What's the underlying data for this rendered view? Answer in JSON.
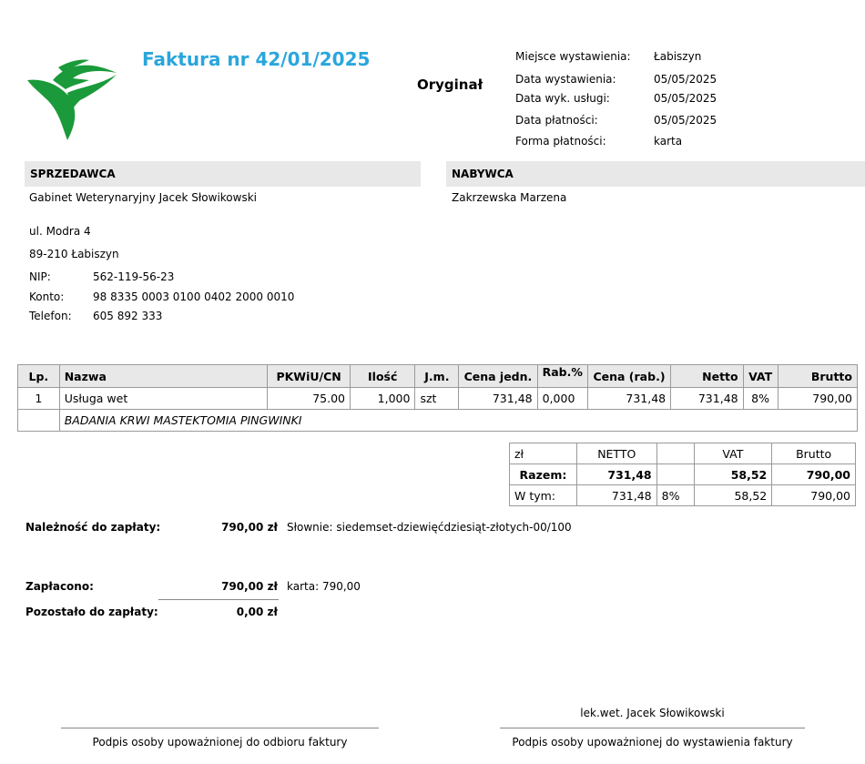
{
  "invoice": {
    "title": "Faktura nr 42/01/2025",
    "copy_label": "Oryginał"
  },
  "meta": [
    {
      "label": "Miejsce wystawienia:",
      "value": "Łabiszyn"
    },
    {
      "label": "Data wystawienia:",
      "value": "05/05/2025"
    },
    {
      "label": "Data wyk. usługi:",
      "value": "05/05/2025"
    },
    {
      "label": "Data płatności:",
      "value": "05/05/2025"
    },
    {
      "label": "Forma płatności:",
      "value": "karta"
    }
  ],
  "seller": {
    "header": "SPRZEDAWCA",
    "name": "Gabinet Weterynaryjny Jacek Słowikowski",
    "street": "ul. Modra 4",
    "city": "89-210 Łabiszyn",
    "nip_label": "NIP:",
    "nip": "562-119-56-23",
    "account_label": "Konto:",
    "account": "98 8335 0003 0100 0402 2000 0010",
    "phone_label": "Telefon:",
    "phone": "605 892 333"
  },
  "buyer": {
    "header": "NABYWCA",
    "name": "Zakrzewska Marzena"
  },
  "items_table": {
    "headers": [
      "Lp.",
      "Nazwa",
      "PKWiU/CN",
      "Ilość",
      "J.m.",
      "Cena jedn.",
      "Rab.%",
      "Cena (rab.)",
      "Netto",
      "VAT",
      "Brutto"
    ],
    "rows": [
      {
        "lp": "1",
        "name": "Usługa wet",
        "pkwiu": "75.00",
        "qty": "1,000",
        "unit": "szt",
        "price": "731,48",
        "discount": "0,000",
        "price_disc": "731,48",
        "net": "731,48",
        "vat": "8%",
        "gross": "790,00",
        "description": "BADANIA KRWI MASTEKTOMIA PINGWINKI"
      }
    ]
  },
  "summary": {
    "headers": [
      "zł",
      "NETTO",
      "",
      "VAT",
      "Brutto"
    ],
    "total": {
      "label": "Razem:",
      "net": "731,48",
      "vat": "58,52",
      "gross": "790,00"
    },
    "breakdown": {
      "label": "W tym:",
      "net": "731,48",
      "rate": "8%",
      "vat": "58,52",
      "gross": "790,00"
    }
  },
  "payment": {
    "due_label": "Należność do zapłaty:",
    "due_amount": "790,00 zł",
    "words": "Słownie: siedemset-dziewięćdziesiąt-złotych-00/100",
    "paid_label": "Zapłacono:",
    "paid_amount": "790,00 zł",
    "paid_method": "karta: 790,00",
    "remaining_label": "Pozostało do zapłaty:",
    "remaining_amount": "0,00 zł"
  },
  "signatures": {
    "issuer_name": "lek.wet. Jacek Słowikowski",
    "receiver_caption": "Podpis osoby upoważnionej do odbioru faktury",
    "issuer_caption": "Podpis osoby upoważnionej do wystawienia faktury"
  },
  "colors": {
    "title": "#2aa6dc",
    "logo_green": "#1a9a3a",
    "header_bg": "#e8e8e8"
  }
}
